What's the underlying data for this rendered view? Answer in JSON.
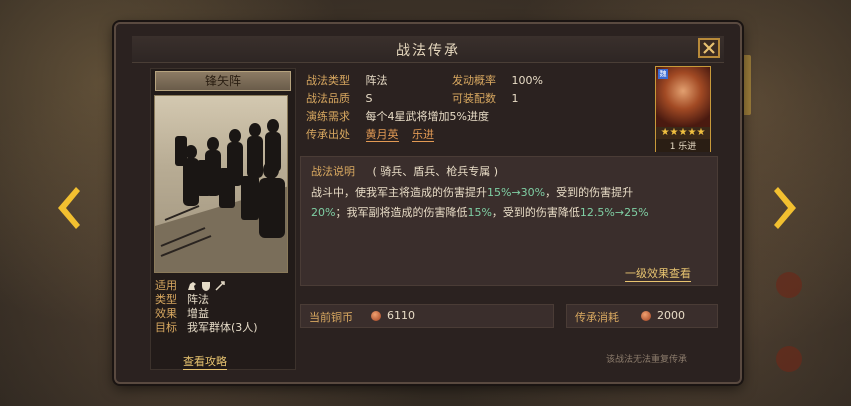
{
  "dialog": {
    "title": "战法传承",
    "close_icon": "close-icon"
  },
  "tactic_card": {
    "name": "锋矢阵",
    "stats": [
      {
        "label": "适用",
        "value": ""
      },
      {
        "label": "类型",
        "value": "阵法"
      },
      {
        "label": "效果",
        "value": "增益"
      },
      {
        "label": "目标",
        "value": "我军群体(3人)"
      }
    ],
    "unit_icons": [
      "cavalry-icon",
      "shield-icon",
      "spear-icon"
    ],
    "guide_link": "查看攻略"
  },
  "info": {
    "type_label": "战法类型",
    "type_value": "阵法",
    "rate_label": "发动概率",
    "rate_value": "100%",
    "quality_label": "战法品质",
    "quality_value": "S",
    "slots_label": "可装配数",
    "slots_value": "1",
    "req_label": "演练需求",
    "req_value": "每个4星武将增加5%进度",
    "source_label": "传承出处",
    "sources": [
      "黄月英",
      "乐进"
    ]
  },
  "hero": {
    "badge": "魏",
    "stars": "★★★★★",
    "level": "1 乐进"
  },
  "description": {
    "title_label": "战法说明",
    "title_value": "( 骑兵、盾兵、枪兵专属 )",
    "line1_a": "战斗中，使我军主将造成的伤害提升",
    "line1_hl": "15%→30%",
    "line1_b": "，受到的伤害提升",
    "line2_hl1": "20%",
    "line2_a": "；我军副将造成的伤害降低",
    "line2_hl2": "15%",
    "line2_b": "，受到的伤害降低",
    "line2_hl3": "12.5%→25%",
    "link": "一级效果查看"
  },
  "coins": {
    "current_label": "当前铜币",
    "current_value": "6110",
    "cost_label": "传承消耗",
    "cost_value": "2000"
  },
  "footer_note": "该战法无法重复传承",
  "colors": {
    "accent_gold": "#d8a860",
    "highlight_green": "#7fcfa4",
    "panel_bg": "#2b2220",
    "link_orange": "#e29a54"
  }
}
